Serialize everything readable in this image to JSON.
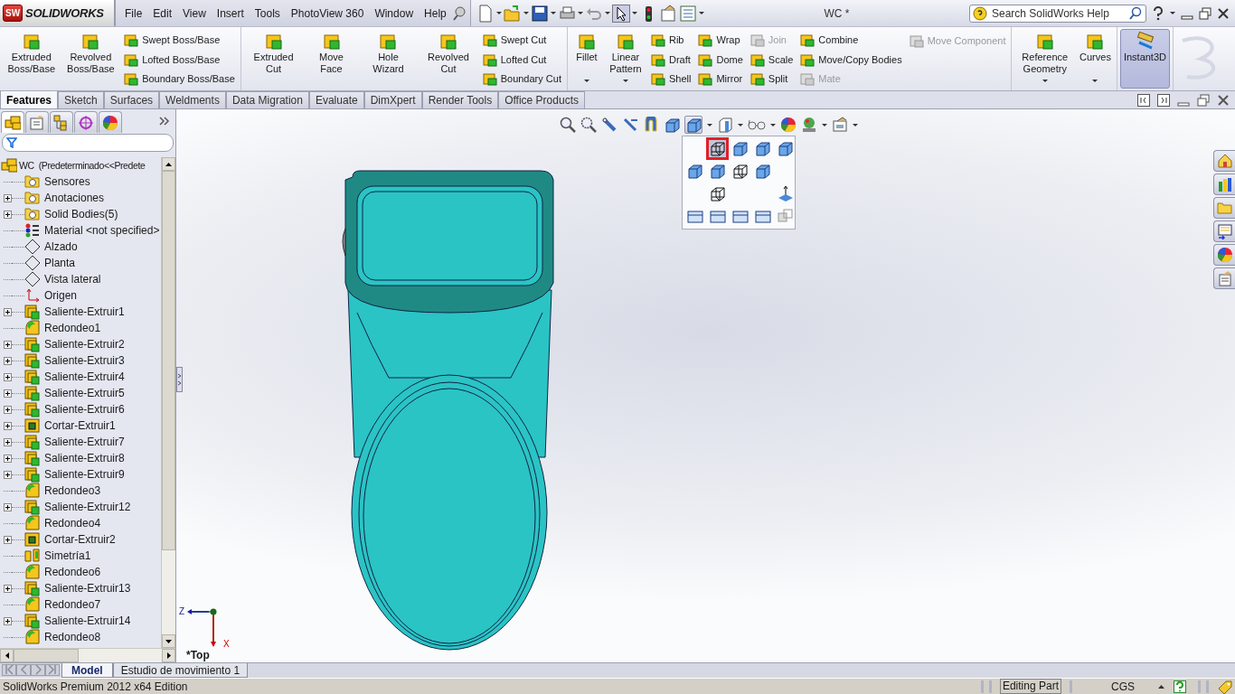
{
  "app": {
    "logo_badge": "SW",
    "logo_text": "SOLIDWORKS",
    "menu": [
      "File",
      "Edit",
      "View",
      "Insert",
      "Tools",
      "PhotoView 360",
      "Window",
      "Help"
    ],
    "document_title": "WC *",
    "search": {
      "placeholder": "Search SolidWorks Help"
    }
  },
  "ribbon": {
    "groups": [
      {
        "columns": [
          {
            "kind": "large",
            "label": "Extruded Boss/Base",
            "has_menu": false,
            "selected": false
          },
          {
            "kind": "large",
            "label": "Revolved Boss/Base",
            "has_menu": false,
            "selected": false
          },
          {
            "kind": "stack",
            "buttons": [
              {
                "label": "Swept Boss/Base",
                "disabled": false
              },
              {
                "label": "Lofted Boss/Base",
                "disabled": false
              },
              {
                "label": "Boundary Boss/Base",
                "disabled": false
              }
            ]
          }
        ]
      },
      {
        "columns": [
          {
            "kind": "large",
            "label": "Extruded Cut",
            "has_menu": false,
            "selected": false
          },
          {
            "kind": "large",
            "label": "Move Face",
            "has_menu": false,
            "selected": false
          },
          {
            "kind": "large",
            "label": "Hole Wizard",
            "has_menu": false,
            "selected": false
          },
          {
            "kind": "large",
            "label": "Revolved Cut",
            "has_menu": false,
            "selected": false
          },
          {
            "kind": "stack",
            "buttons": [
              {
                "label": "Swept Cut",
                "disabled": false
              },
              {
                "label": "Lofted Cut",
                "disabled": false
              },
              {
                "label": "Boundary Cut",
                "disabled": false
              }
            ]
          }
        ]
      },
      {
        "columns": [
          {
            "kind": "large",
            "label": "Fillet",
            "has_menu": true,
            "selected": false
          },
          {
            "kind": "large",
            "label": "Linear Pattern",
            "has_menu": true,
            "selected": false
          },
          {
            "kind": "stack",
            "buttons": [
              {
                "label": "Rib",
                "disabled": false
              },
              {
                "label": "Draft",
                "disabled": false
              },
              {
                "label": "Shell",
                "disabled": false
              }
            ]
          },
          {
            "kind": "stack",
            "buttons": [
              {
                "label": "Wrap",
                "disabled": false
              },
              {
                "label": "Dome",
                "disabled": false
              },
              {
                "label": "Mirror",
                "disabled": false
              }
            ]
          },
          {
            "kind": "stack",
            "buttons": [
              {
                "label": "Join",
                "disabled": true
              },
              {
                "label": "Scale",
                "disabled": false
              },
              {
                "label": "Split",
                "disabled": false
              }
            ]
          },
          {
            "kind": "stack",
            "buttons": [
              {
                "label": "Combine",
                "disabled": false
              },
              {
                "label": "Move/Copy Bodies",
                "disabled": false
              },
              {
                "label": "Mate",
                "disabled": true
              }
            ]
          },
          {
            "kind": "stack",
            "buttons": [
              {
                "label": "Move Component",
                "disabled": true
              }
            ]
          }
        ]
      },
      {
        "columns": [
          {
            "kind": "large",
            "label": "Reference Geometry",
            "has_menu": true,
            "selected": false
          },
          {
            "kind": "large",
            "label": "Curves",
            "has_menu": true,
            "selected": false
          }
        ]
      },
      {
        "columns": [
          {
            "kind": "large",
            "label": "Instant3D",
            "has_menu": false,
            "selected": true
          }
        ]
      }
    ]
  },
  "command_tabs": [
    {
      "label": "Features",
      "selected": true
    },
    {
      "label": "Sketch",
      "selected": false
    },
    {
      "label": "Surfaces",
      "selected": false
    },
    {
      "label": "Weldments",
      "selected": false
    },
    {
      "label": "Data Migration",
      "selected": false
    },
    {
      "label": "Evaluate",
      "selected": false
    },
    {
      "label": "DimXpert",
      "selected": false
    },
    {
      "label": "Render Tools",
      "selected": false
    },
    {
      "label": "Office Products",
      "selected": false
    }
  ],
  "feature_tree": {
    "panel_tabs": [
      {
        "selected": true
      },
      {
        "selected": false
      },
      {
        "selected": false
      },
      {
        "selected": false
      },
      {
        "selected": false
      }
    ],
    "root": {
      "label": "WC  (Predeterminado<<Predete",
      "kind": "part",
      "children": [
        {
          "label": "Sensores",
          "kind": "folder",
          "expandable": false
        },
        {
          "label": "Anotaciones",
          "kind": "folder",
          "expandable": true
        },
        {
          "label": "Solid Bodies(5)",
          "kind": "folder",
          "expandable": true
        },
        {
          "label": "Material <not specified>",
          "kind": "material",
          "expandable": false
        },
        {
          "label": "Alzado",
          "kind": "plane",
          "expandable": false
        },
        {
          "label": "Planta",
          "kind": "plane",
          "expandable": false
        },
        {
          "label": "Vista lateral",
          "kind": "plane",
          "expandable": false
        },
        {
          "label": "Origen",
          "kind": "origin",
          "expandable": false
        },
        {
          "label": "Saliente-Extruir1",
          "kind": "boss",
          "expandable": true
        },
        {
          "label": "Redondeo1",
          "kind": "fillet",
          "expandable": false
        },
        {
          "label": "Saliente-Extruir2",
          "kind": "boss",
          "expandable": true
        },
        {
          "label": "Saliente-Extruir3",
          "kind": "boss",
          "expandable": true
        },
        {
          "label": "Saliente-Extruir4",
          "kind": "boss",
          "expandable": true
        },
        {
          "label": "Saliente-Extruir5",
          "kind": "boss",
          "expandable": true
        },
        {
          "label": "Saliente-Extruir6",
          "kind": "boss",
          "expandable": true
        },
        {
          "label": "Cortar-Extruir1",
          "kind": "cut",
          "expandable": true
        },
        {
          "label": "Saliente-Extruir7",
          "kind": "boss",
          "expandable": true
        },
        {
          "label": "Saliente-Extruir8",
          "kind": "boss",
          "expandable": true
        },
        {
          "label": "Saliente-Extruir9",
          "kind": "boss",
          "expandable": true
        },
        {
          "label": "Redondeo3",
          "kind": "fillet",
          "expandable": false
        },
        {
          "label": "Saliente-Extruir12",
          "kind": "boss",
          "expandable": true
        },
        {
          "label": "Redondeo4",
          "kind": "fillet",
          "expandable": false
        },
        {
          "label": "Cortar-Extruir2",
          "kind": "cut",
          "expandable": true
        },
        {
          "label": "Simetría1",
          "kind": "mirror",
          "expandable": false
        },
        {
          "label": "Redondeo6",
          "kind": "fillet",
          "expandable": false
        },
        {
          "label": "Saliente-Extruir13",
          "kind": "boss",
          "expandable": true
        },
        {
          "label": "Redondeo7",
          "kind": "fillet",
          "expandable": false
        },
        {
          "label": "Saliente-Extruir14",
          "kind": "boss",
          "expandable": true
        },
        {
          "label": "Redondeo8",
          "kind": "fillet",
          "expandable": false
        }
      ]
    }
  },
  "viewport": {
    "view_label": "*Top",
    "triad": {
      "axis_1": "Z",
      "axis_2": "X"
    },
    "view_menu": {
      "items": [
        {
          "kind": "cube",
          "selected": true
        },
        {
          "kind": "cube",
          "selected": false
        },
        {
          "kind": "cube",
          "selected": false
        },
        {
          "kind": "cube",
          "selected": false
        },
        {
          "kind": "cube",
          "selected": false
        },
        {
          "kind": "cube",
          "selected": false
        },
        {
          "kind": "cube",
          "selected": false
        },
        {
          "kind": "cube",
          "selected": false
        },
        {
          "kind": "cube",
          "selected": false
        },
        {
          "kind": "normal",
          "selected": false
        },
        {
          "kind": "layout",
          "selected": false
        },
        {
          "kind": "layout",
          "selected": false
        },
        {
          "kind": "layout",
          "selected": false
        },
        {
          "kind": "layout",
          "selected": false
        },
        {
          "kind": "link",
          "selected": false
        }
      ]
    }
  },
  "bottom_tabs": [
    {
      "label": "Model",
      "selected": true
    },
    {
      "label": "Estudio de movimiento 1",
      "selected": false
    }
  ],
  "status_bar": {
    "edition": "SolidWorks Premium 2012 x64 Edition",
    "mode": "Editing Part",
    "units": "CGS"
  }
}
